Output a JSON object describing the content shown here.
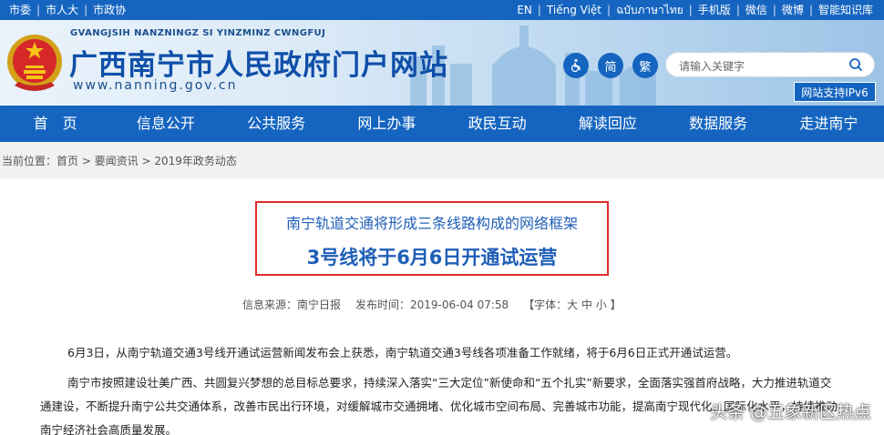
{
  "topbar": {
    "left_items": [
      "市委",
      "市人大",
      "市政协"
    ],
    "right_items": [
      "EN",
      "Tiếng Việt",
      "ฉบับภาษาไทย",
      "手机版",
      "微信",
      "微博",
      "智能知识库"
    ]
  },
  "header": {
    "pinyin": "GVANGJSIH NANZNINGZ SI YINZMINZ CWNGFUJ",
    "title": "广西南宁市人民政府门户网站",
    "url": "www.nanning.gov.cn",
    "btn_simplified": "简",
    "btn_traditional": "繁",
    "accessibility_icon": "wheelchair-icon",
    "search_placeholder": "请输入关键字",
    "ipv6_badge": "网站支持IPv6"
  },
  "nav": {
    "items": [
      "首　页",
      "信息公开",
      "公共服务",
      "网上办事",
      "政民互动",
      "解读回应",
      "数据服务",
      "走进南宁"
    ]
  },
  "breadcrumb": "当前位置：首页 > 要闻资讯 > 2019年政务动态",
  "article": {
    "subtitle": "南宁轨道交通将形成三条线路构成的网络框架",
    "title": "3号线将于6月6日开通试运营",
    "source": "信息来源：南宁日报",
    "publish_time": "发布时间：2019-06-04 07:58",
    "font_size": "【字体：大 中 小 】",
    "paragraph1": "6月3日，从南宁轨道交通3号线开通试运营新闻发布会上获悉，南宁轨道交通3号线各项准备工作就绪，将于6月6日正式开通试运营。",
    "paragraph2": "南宁市按照建设壮美广西、共圆复兴梦想的总目标总要求，持续深入落实“三大定位”新使命和“五个扎实”新要求，全面落实强首府战略，大力推进轨道交通建设，不断提升南宁公共交通体系，改善市民出行环境，对缓解城市交通拥堵、优化城市空间布局、完善城市功能，提高南宁现代化、国际化水平，持续推动南宁经济社会高质量发展。"
  },
  "watermark": "头条 @五象新区热点",
  "colors": {
    "brand_blue": "#1565c0",
    "title_blue": "#1f5fb8",
    "highlight_red": "#e12b2b"
  }
}
